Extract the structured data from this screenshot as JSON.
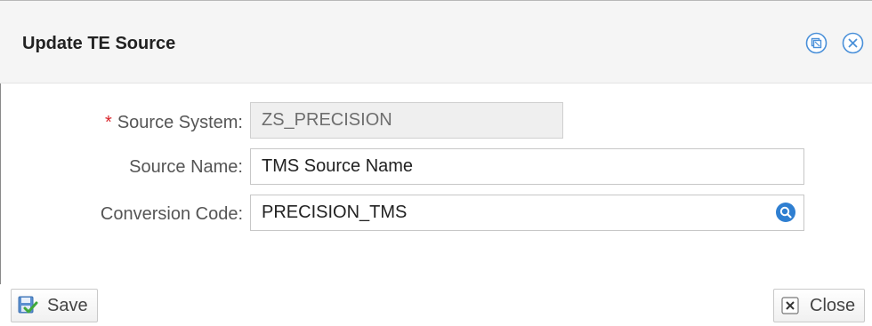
{
  "dialog": {
    "title": "Update TE Source"
  },
  "form": {
    "source_system": {
      "required_marker": "*",
      "label": "Source System:",
      "value": "ZS_PRECISION"
    },
    "source_name": {
      "label": "Source Name:",
      "value": "TMS Source Name"
    },
    "conversion_code": {
      "label": "Conversion Code:",
      "value": "PRECISION_TMS"
    }
  },
  "buttons": {
    "save_label": "Save",
    "close_label": "Close"
  },
  "icons": {
    "maximize": "restore-window-icon",
    "close": "close-circle-icon",
    "lookup": "search-icon",
    "save": "save-check-icon",
    "close_button": "close-x-icon"
  },
  "colors": {
    "required": "#d9262c",
    "accent": "#2f7fd1",
    "header_bg": "#f5f5f5"
  }
}
